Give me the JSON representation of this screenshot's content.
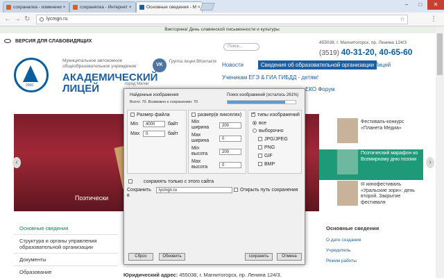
{
  "browser": {
    "tabs": [
      {
        "label": "сохраналка - изменени ×"
      },
      {
        "label": "сохранялка - Интернет ×"
      },
      {
        "label": "Основные сведения - М ×"
      }
    ],
    "url": "lycmgn.ru",
    "window_controls": [
      "–",
      "□",
      "✕"
    ]
  },
  "site": {
    "top_strip": "Викторина! День славянской письменности и культуры",
    "accessibility": "ВЕРСИЯ ДЛЯ СЛАБОВИДЯЩИХ",
    "search_placeholder": "Поиск...",
    "address": "455038, г. Магнитогорск, пр. Ленина 124/3",
    "phone_code": "(3519)",
    "phone_numbers": "40-31-20, 40-65-60",
    "logo_year": "2000",
    "school_sub": "Муниципальное автономное общеобразовательное учреждение",
    "school_name_1": "АКАДЕМИЧЕСКИЙ",
    "school_name_2": "ЛИЦЕЙ",
    "school_name_tail": "город Магни",
    "vk_text": "VK",
    "vk_label": "Группа лицея ВКонтакте",
    "nav": {
      "news": "Новости",
      "info": "Сведения об образовательной организации",
      "lyceum": "Лицей",
      "row2": "Ученикам    ЕГЭ & ГИА    ГИБДД - детям!",
      "row3": "ЕКО    Форум"
    },
    "slider_caption": "Поэтически",
    "news": [
      {
        "text": "Фестиваль-конкурс «Планета Медиа»"
      },
      {
        "text": "Поэтический марафон ко Всемирному дню поэзии"
      },
      {
        "text": "III кинофестиваль «Уральские зори»: день второй. Закрытие фестиваля"
      }
    ],
    "left_menu": [
      "Основные сведения",
      "Структура и органы управления образовательной организации",
      "Документы",
      "Образование"
    ],
    "right_side": {
      "heading": "Основные сведения",
      "items": [
        "О дате создания",
        "Учредитель",
        "Режим работы"
      ]
    },
    "legal_label": "Юридический адрес:",
    "legal_value": "455038, г. Магнитогорск, пр. Ленина 124/3."
  },
  "dialog": {
    "found_title": "Найденные изображения",
    "found_count": "Всего: 70. Возможно к сохранению: 70",
    "search_status": "Поиск изображений (осталось 261%)",
    "progress_fraction": 0.85,
    "file_size": {
      "label": "Размер файла",
      "checked": false,
      "min_label": "Min",
      "min_value": "4000",
      "min_unit": "байт",
      "max_label": "Max",
      "max_value": "0",
      "max_unit": "байт"
    },
    "pixel_size": {
      "label": "размер(в пикселях)",
      "checked": false,
      "min_width_label": "Min ширина",
      "min_width": "200",
      "max_width_label": "Max ширина",
      "max_width": "0",
      "min_height_label": "Min высота",
      "min_height": "200",
      "max_height_label": "Max высота",
      "max_height": "0"
    },
    "image_types": {
      "label": "типы изображений",
      "checked": true,
      "all_label": "все",
      "all_selected": true,
      "selective_label": "выборочно",
      "formats": [
        "JPG/JPEG",
        "PNG",
        "GIF",
        "BMP"
      ]
    },
    "this_site_only": "сохранять только с этого сайта",
    "save_to_label": "Сохранить в",
    "save_to_value": "lycmgn.ru",
    "open_path_label": "Открыть путь сохранения",
    "buttons": {
      "reset": "Сброс",
      "refresh": "Обновить",
      "save": "сохранить",
      "cancel": "Отмена"
    }
  }
}
